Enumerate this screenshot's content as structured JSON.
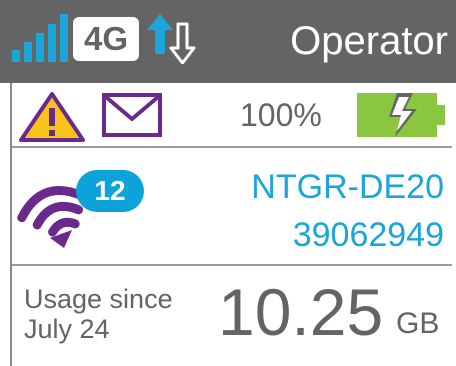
{
  "status_bar": {
    "network_type": "4G",
    "operator": "Operator",
    "icons": {
      "signal": "signal-bars-icon",
      "data_activity": "data-up-down-arrows-icon"
    },
    "colors": {
      "background": "#646464",
      "signal": "#1ba5d9"
    }
  },
  "notifications": {
    "icons": [
      "alert-warning-icon",
      "mail-icon"
    ],
    "battery_percent": "100%",
    "battery_icon": "battery-charging-icon",
    "colors": {
      "warning": "#f7c21a",
      "mail": "#6a2a8c",
      "battery": "#8bc63f"
    }
  },
  "wifi": {
    "connected_clients": "12",
    "ssid": "NTGR-DE20",
    "password": "39062949",
    "icon": "wifi-icon",
    "colors": {
      "wifi": "#6a2a8c",
      "badge": "#0da3da",
      "text": "#1ba5d9"
    }
  },
  "usage": {
    "label_line1": "Usage since",
    "label_line2": "July 24",
    "value": "10.25",
    "unit": "GB"
  }
}
